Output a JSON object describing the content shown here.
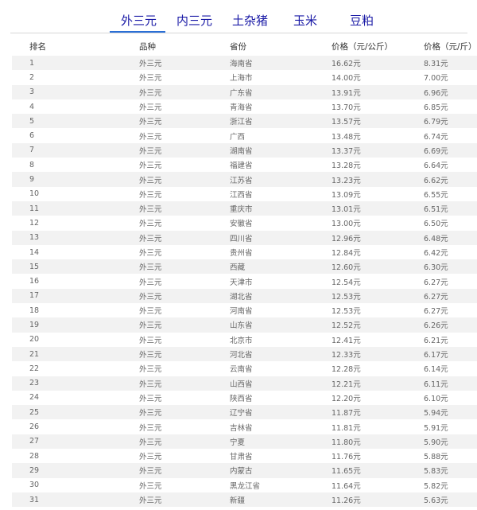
{
  "tabs": [
    "外三元",
    "内三元",
    "土杂猪",
    "玉米",
    "豆粕"
  ],
  "active_tab": 0,
  "colors": {
    "tab_text": "#1a1aa6",
    "underline": "#2a6fd6",
    "row_alt": "#f2f2f2"
  },
  "table": {
    "headers": [
      "排名",
      "品种",
      "省份",
      "价格（元/公斤）",
      "价格（元/斤）"
    ],
    "rows": [
      [
        "1",
        "外三元",
        "海南省",
        "16.62元",
        "8.31元"
      ],
      [
        "2",
        "外三元",
        "上海市",
        "14.00元",
        "7.00元"
      ],
      [
        "3",
        "外三元",
        "广东省",
        "13.91元",
        "6.96元"
      ],
      [
        "4",
        "外三元",
        "青海省",
        "13.70元",
        "6.85元"
      ],
      [
        "5",
        "外三元",
        "浙江省",
        "13.57元",
        "6.79元"
      ],
      [
        "6",
        "外三元",
        "广西",
        "13.48元",
        "6.74元"
      ],
      [
        "7",
        "外三元",
        "湖南省",
        "13.37元",
        "6.69元"
      ],
      [
        "8",
        "外三元",
        "福建省",
        "13.28元",
        "6.64元"
      ],
      [
        "9",
        "外三元",
        "江苏省",
        "13.23元",
        "6.62元"
      ],
      [
        "10",
        "外三元",
        "江西省",
        "13.09元",
        "6.55元"
      ],
      [
        "11",
        "外三元",
        "重庆市",
        "13.01元",
        "6.51元"
      ],
      [
        "12",
        "外三元",
        "安徽省",
        "13.00元",
        "6.50元"
      ],
      [
        "13",
        "外三元",
        "四川省",
        "12.96元",
        "6.48元"
      ],
      [
        "14",
        "外三元",
        "贵州省",
        "12.84元",
        "6.42元"
      ],
      [
        "15",
        "外三元",
        "西藏",
        "12.60元",
        "6.30元"
      ],
      [
        "16",
        "外三元",
        "天津市",
        "12.54元",
        "6.27元"
      ],
      [
        "17",
        "外三元",
        "湖北省",
        "12.53元",
        "6.27元"
      ],
      [
        "18",
        "外三元",
        "河南省",
        "12.53元",
        "6.27元"
      ],
      [
        "19",
        "外三元",
        "山东省",
        "12.52元",
        "6.26元"
      ],
      [
        "20",
        "外三元",
        "北京市",
        "12.41元",
        "6.21元"
      ],
      [
        "21",
        "外三元",
        "河北省",
        "12.33元",
        "6.17元"
      ],
      [
        "22",
        "外三元",
        "云南省",
        "12.28元",
        "6.14元"
      ],
      [
        "23",
        "外三元",
        "山西省",
        "12.21元",
        "6.11元"
      ],
      [
        "24",
        "外三元",
        "陕西省",
        "12.20元",
        "6.10元"
      ],
      [
        "25",
        "外三元",
        "辽宁省",
        "11.87元",
        "5.94元"
      ],
      [
        "26",
        "外三元",
        "吉林省",
        "11.81元",
        "5.91元"
      ],
      [
        "27",
        "外三元",
        "宁夏",
        "11.80元",
        "5.90元"
      ],
      [
        "28",
        "外三元",
        "甘肃省",
        "11.76元",
        "5.88元"
      ],
      [
        "29",
        "外三元",
        "内蒙古",
        "11.65元",
        "5.83元"
      ],
      [
        "30",
        "外三元",
        "黑龙江省",
        "11.64元",
        "5.82元"
      ],
      [
        "31",
        "外三元",
        "新疆",
        "11.26元",
        "5.63元"
      ]
    ]
  }
}
